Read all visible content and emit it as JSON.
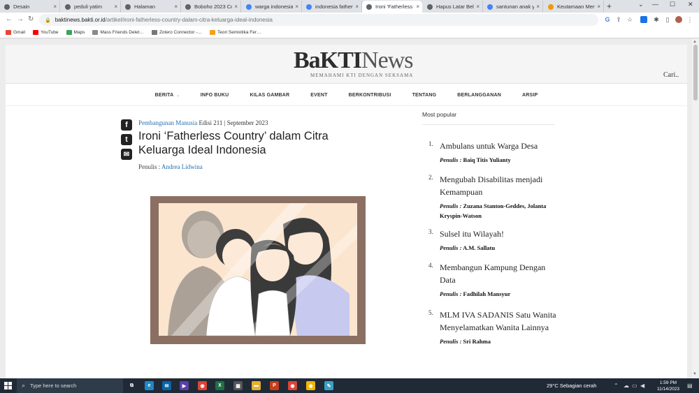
{
  "browser": {
    "tabs": [
      {
        "label": "Desain",
        "icon": "globe-icon",
        "color": "#5f6368"
      },
      {
        "label": "peduli yatim",
        "icon": "globe-icon",
        "color": "#5f6368"
      },
      {
        "label": "Halaman",
        "icon": "globe-icon",
        "color": "#5f6368"
      },
      {
        "label": "Boboho 2023 Co…",
        "icon": "globe-icon",
        "color": "#5f6368"
      },
      {
        "label": "warga indonesia …",
        "icon": "google-icon",
        "color": "#4285f4"
      },
      {
        "label": "indonesia fatherl…",
        "icon": "google-icon",
        "color": "#4285f4"
      },
      {
        "label": "Ironi 'Fatherless C…",
        "icon": "globe-icon",
        "color": "#5f6368"
      },
      {
        "label": "Hapus Latar Belak…",
        "icon": "eye-icon",
        "color": "#5f6368"
      },
      {
        "label": "santunan anak ya…",
        "icon": "google-icon",
        "color": "#4285f4"
      },
      {
        "label": "Keutamaan Meny…",
        "icon": "site-icon",
        "color": "#f29900"
      }
    ],
    "tab_close": "×",
    "new_tab": "+",
    "window_controls": {
      "dropdown": "⌄",
      "minimize": "—",
      "maximize": "☐",
      "close": "✕"
    },
    "nav": {
      "back": "←",
      "forward": "→",
      "reload": "↻"
    },
    "url_host": "baktinews.bakti.or.id",
    "url_path": "/artikel/ironi-fatherless-country-dalam-citra-keluarga-ideal-indonesia",
    "bookmarks": [
      {
        "label": "Gmail",
        "color": "#ea4335"
      },
      {
        "label": "YouTube",
        "color": "#ff0000"
      },
      {
        "label": "Maps",
        "color": "#34a853"
      },
      {
        "label": "Mass Friends Delet…",
        "color": "#8a8a8a"
      },
      {
        "label": "Zotero Connector -…",
        "color": "#777777"
      },
      {
        "label": "Teori Semiotika Fer…",
        "color": "#f4a11c"
      }
    ]
  },
  "site": {
    "logo_bold": "BaKTI",
    "logo_light": "News",
    "tagline": "MEMAHAMI KTI DENGAN SEKSAMA",
    "search_label": "Cari..",
    "nav": [
      "BERITA",
      "INFO BUKU",
      "KILAS GAMBAR",
      "EVENT",
      "BERKONTRIBUSI",
      "TENTANG",
      "BERLANGGANAN",
      "ARSIP"
    ],
    "nav_caret": "⌄"
  },
  "article": {
    "category": "Pembangunan Manusia",
    "edition": " Edisi 211 | September 2023",
    "title": "Ironi ‘Fatherless Country’ dalam Citra Keluarga Ideal Indonesia",
    "author_prefix": "Penulis : ",
    "author": "Andrea Lidwina",
    "share": {
      "facebook": "f",
      "twitter": "t",
      "email": "✉"
    }
  },
  "sidebar": {
    "title": "Most popular",
    "author_label": "Penulis :",
    "items": [
      {
        "num": "1.",
        "title": "Ambulans untuk Warga Desa",
        "author": "Baiq Titis Yulianty"
      },
      {
        "num": "2.",
        "title": "Mengubah Disabilitas menjadi Kemampuan",
        "author": "Zuzana Stanton-Geddes, Jolanta Kryspin-Watson"
      },
      {
        "num": "3.",
        "title": "Sulsel itu Wilayah!",
        "author": "A.M. Sallatu"
      },
      {
        "num": "4.",
        "title": "Membangun Kampung Dengan Data",
        "author": "Fadhilah Mansyur"
      },
      {
        "num": "5.",
        "title": "MLM IVA SADANIS Satu Wanita Menyelamatkan Wanita Lainnya",
        "author": "Sri Rahma"
      }
    ]
  },
  "taskbar": {
    "search_placeholder": "Type here to search",
    "weather": "29°C  Sebagian cerah",
    "time": "1:59 PM",
    "date": "11/14/2023",
    "apps": [
      {
        "name": "task-view-icon",
        "glyph": "⧉",
        "color": "#1f2a36"
      },
      {
        "name": "edge-icon",
        "glyph": "e",
        "color": "#1e88c8"
      },
      {
        "name": "mail-icon",
        "glyph": "✉",
        "color": "#0a64a8"
      },
      {
        "name": "media-icon",
        "glyph": "▶",
        "color": "#5b3fa8"
      },
      {
        "name": "chrome-icon",
        "glyph": "◉",
        "color": "#db4437"
      },
      {
        "name": "excel-icon",
        "glyph": "X",
        "color": "#1d7044"
      },
      {
        "name": "calculator-icon",
        "glyph": "▦",
        "color": "#555555"
      },
      {
        "name": "file-explorer-icon",
        "glyph": "▬",
        "color": "#e8b02e"
      },
      {
        "name": "powerpoint-icon",
        "glyph": "P",
        "color": "#c43e1c"
      },
      {
        "name": "chrome-active-icon",
        "glyph": "◉",
        "color": "#db4437"
      },
      {
        "name": "chrome-2-icon",
        "glyph": "◉",
        "color": "#f2b600"
      },
      {
        "name": "notes-icon",
        "glyph": "✎",
        "color": "#3aa0c8"
      }
    ]
  }
}
